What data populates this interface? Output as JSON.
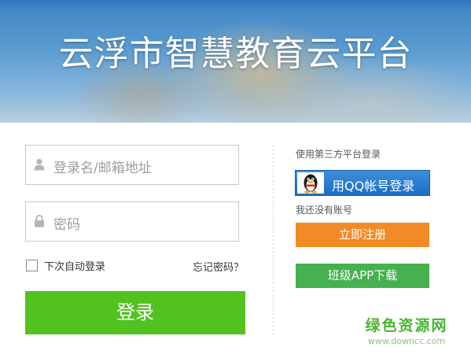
{
  "hero": {
    "title": "云浮市智慧教育云平台"
  },
  "login": {
    "username_placeholder": "登录名/邮箱地址",
    "password_placeholder": "密码",
    "remember_label": "下次自动登录",
    "forgot_label": "忘记密码？",
    "submit_label": "登录"
  },
  "side": {
    "third_party_title": "使用第三方平台登录",
    "qq_label": "用QQ帐号登录",
    "no_account_title": "我还没有账号",
    "register_label": "立即注册",
    "app_download_label": "班级APP下载"
  },
  "watermark": {
    "brand": "绿色资源网",
    "url": "www.downcc.com"
  },
  "colors": {
    "login_green": "#52c221",
    "register_orange": "#f28a26",
    "app_green": "#45b14f",
    "qq_blue": "#1b6cc4"
  },
  "icons": [
    "user-icon",
    "lock-icon",
    "qq-penguin-icon"
  ]
}
